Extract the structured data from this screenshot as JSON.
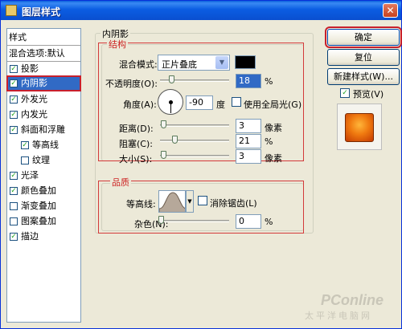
{
  "window": {
    "title": "图层样式"
  },
  "sidebar": {
    "header": "样式",
    "blend_options": "混合选项:默认",
    "items": [
      {
        "label": "投影",
        "checked": true
      },
      {
        "label": "内阴影",
        "checked": true,
        "selected": true
      },
      {
        "label": "外发光",
        "checked": true
      },
      {
        "label": "内发光",
        "checked": true
      },
      {
        "label": "斜面和浮雕",
        "checked": true
      },
      {
        "label": "等高线",
        "checked": true,
        "indent": true
      },
      {
        "label": "纹理",
        "checked": false,
        "indent": true
      },
      {
        "label": "光泽",
        "checked": true
      },
      {
        "label": "颜色叠加",
        "checked": true
      },
      {
        "label": "渐变叠加",
        "checked": false
      },
      {
        "label": "图案叠加",
        "checked": false
      },
      {
        "label": "描边",
        "checked": true
      }
    ]
  },
  "panel": {
    "title": "内阴影",
    "structure": {
      "title": "结构",
      "blend_mode_label": "混合模式:",
      "blend_mode_value": "正片叠底",
      "shadow_color": "#000000",
      "opacity_label": "不透明度(O):",
      "opacity_value": "18",
      "opacity_unit": "%",
      "angle_label": "角度(A):",
      "angle_value": "-90",
      "angle_unit": "度",
      "global_light_label": "使用全局光(G)",
      "global_light_checked": false,
      "distance_label": "距离(D):",
      "distance_value": "3",
      "distance_unit": "像素",
      "choke_label": "阻塞(C):",
      "choke_value": "21",
      "choke_unit": "%",
      "size_label": "大小(S):",
      "size_value": "3",
      "size_unit": "像素"
    },
    "quality": {
      "title": "品质",
      "contour_label": "等高线:",
      "antialias_label": "消除锯齿(L)",
      "antialias_checked": false,
      "noise_label": "杂色(N):",
      "noise_value": "0",
      "noise_unit": "%"
    }
  },
  "buttons": {
    "ok": "确定",
    "reset": "复位",
    "new_style": "新建样式(W)...",
    "preview_label": "预览(V)",
    "preview_checked": true
  },
  "watermark": {
    "brand": "PConline",
    "sub": "太平洋电脑网"
  },
  "colors": {
    "selection": "#316ac5",
    "highlight_box": "#d33a3a",
    "titlebar": "#0a5fdc",
    "check": "#21a121",
    "preview_fill": "#f07a10"
  }
}
